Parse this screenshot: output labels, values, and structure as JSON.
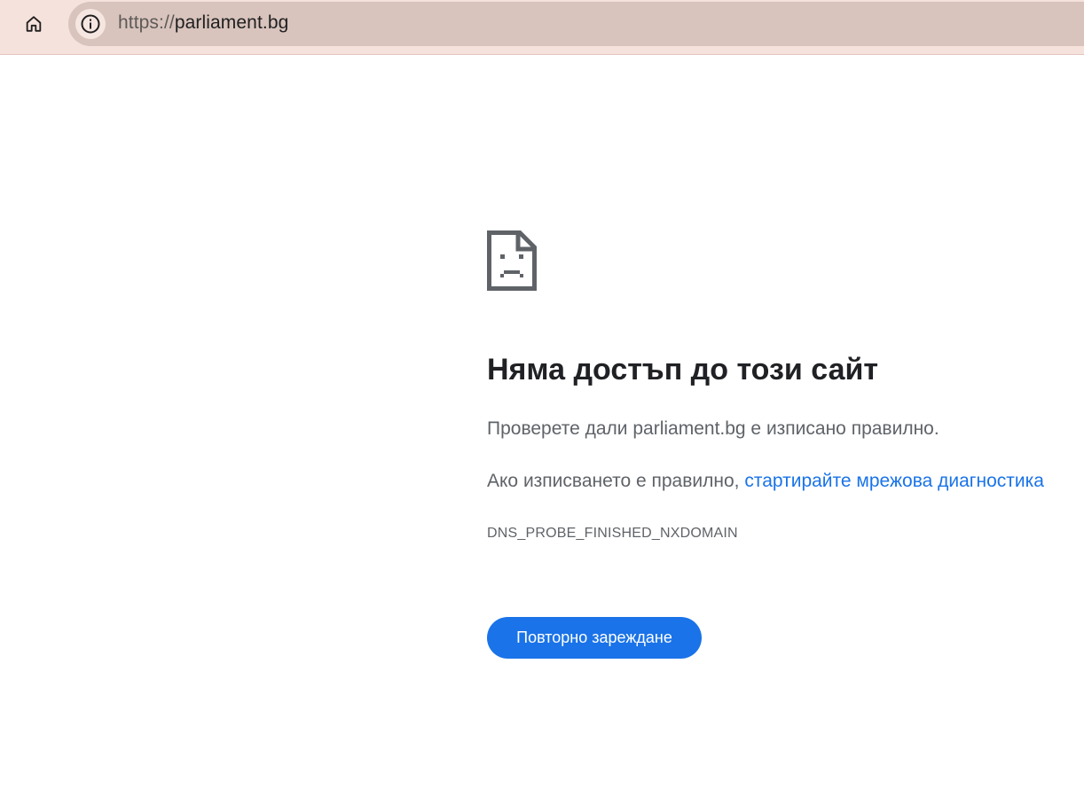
{
  "toolbar": {
    "url_scheme": "https://",
    "url_host": "parliament.bg"
  },
  "error_page": {
    "heading": "Няма достъп до този сайт",
    "check_text": "Проверете дали parliament.bg е изписано правилно.",
    "spelling_prefix": "Ако изписването е правилно, ",
    "diagnostics_link": "стартирайте мрежова диагностика",
    "error_code": "DNS_PROBE_FINISHED_NXDOMAIN",
    "reload_button": "Повторно зареждане"
  },
  "colors": {
    "toolbar_bg": "#f6e2dc",
    "omnibox_bg": "#d8c4bd",
    "link": "#1a73e8",
    "button": "#1a73e8"
  },
  "icons": {
    "home": "home-icon",
    "site_info": "info-icon",
    "error": "sad-page-icon"
  }
}
